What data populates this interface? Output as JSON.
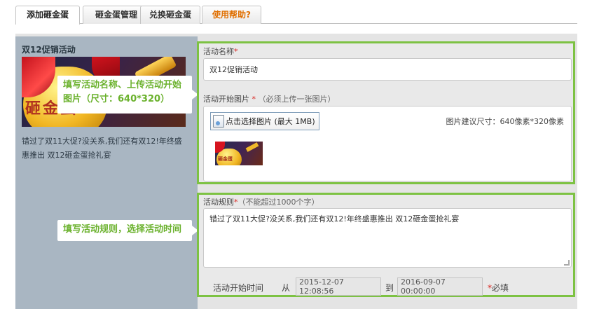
{
  "tabs": [
    {
      "label": "添加砸金蛋"
    },
    {
      "label": "砸金蛋管理"
    },
    {
      "label": "兑换砸金蛋"
    },
    {
      "label": "使用帮助?"
    }
  ],
  "preview": {
    "title": "双12促销活动",
    "banner_text": "砸金蛋",
    "description": "错过了双11大促?没关系,我们还有双12!年终盛惠推出 双12砸金蛋抢礼宴"
  },
  "callouts": {
    "upload": "填写活动名称、上传活动开始图片（尺寸：640*320）",
    "rules": "填写活动规则，选择活动时间"
  },
  "form": {
    "name_label": "活动名称",
    "required_mark": "*",
    "name_value": "双12促销活动",
    "image_label": "活动开始图片",
    "image_hint": "（必须上传一张图片）",
    "upload_button": "点击选择图片 (最大 1MB)",
    "size_hint": "图片建议尺寸：640像素*320像素",
    "thumb_text": "砸金蛋",
    "rules_label": "活动规则",
    "rules_hint": "（不能超过1000个字）",
    "rules_value": "错过了双11大促?没关系,我们还有双12!年终盛惠推出 双12砸金蛋抢礼宴",
    "time_label": "活动开始时间",
    "from_label": "从",
    "start_time": "2015-12-07 12:08:56",
    "to_label": "到",
    "end_time": "2016-09-07 00:00:00",
    "required_text": "必填"
  },
  "colors": {
    "accent_green": "#7dc243",
    "callout_text": "#6ab12c",
    "required_red": "#d8221c",
    "help_tab_orange": "#e06f00"
  }
}
